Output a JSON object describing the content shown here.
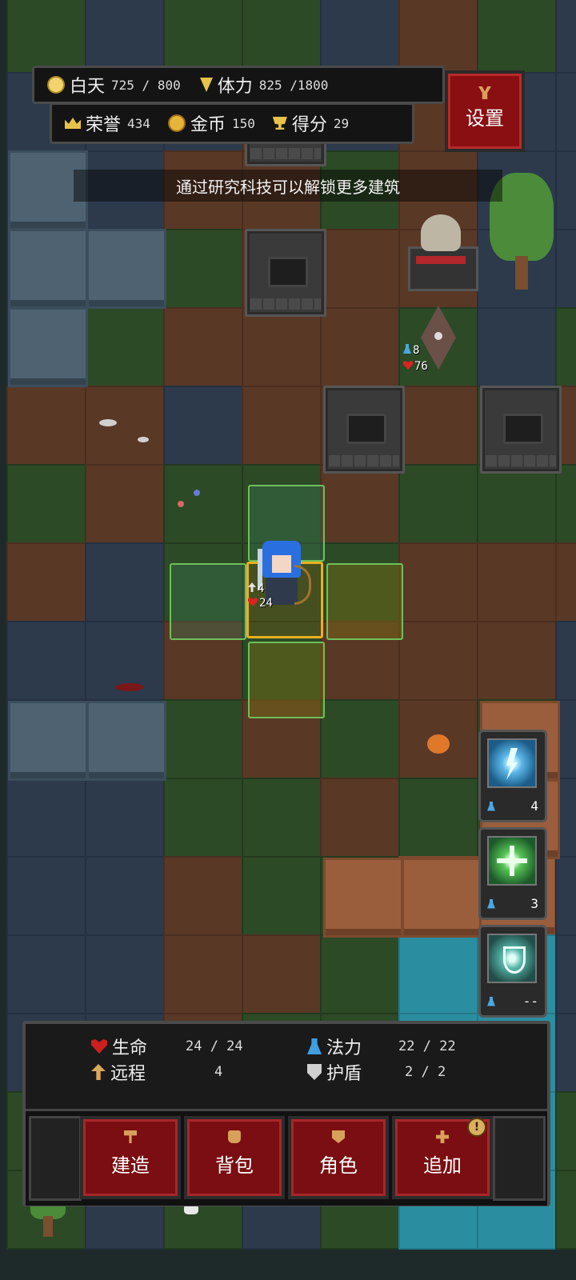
{
  "hud": {
    "day_label": "白天",
    "day_value": "725 / 800",
    "stamina_label": "体力",
    "stamina_value": "825 /1800",
    "honor_label": "荣誉",
    "honor_value": "434",
    "gold_label": "金币",
    "gold_value": "150",
    "score_label": "得分",
    "score_value": "29",
    "settings_label": "设置"
  },
  "tip": "通过研究科技可以解锁更多建筑",
  "hero": {
    "attack": "4",
    "hp": "24"
  },
  "enemy": {
    "mana": "8",
    "hp": "76"
  },
  "skills": [
    {
      "name": "lightning",
      "cost": "4"
    },
    {
      "name": "heal",
      "cost": "3"
    },
    {
      "name": "shield",
      "cost": "--"
    }
  ],
  "stats": {
    "hp_label": "生命",
    "hp_value": "24 / 24",
    "mp_label": "法力",
    "mp_value": "22 / 22",
    "ranged_label": "远程",
    "ranged_value": "4",
    "shield_label": "护盾",
    "shield_value": "2 / 2"
  },
  "buttons": {
    "build": "建造",
    "bag": "背包",
    "role": "角色",
    "add": "追加",
    "add_alert": "!"
  },
  "colors": {
    "button_red": "#7a0e12",
    "hp_red": "#cc1f1f",
    "mana_blue": "#3f9fe0",
    "selection_yellow": "#e8b020",
    "move_green": "#6fbf5a"
  }
}
